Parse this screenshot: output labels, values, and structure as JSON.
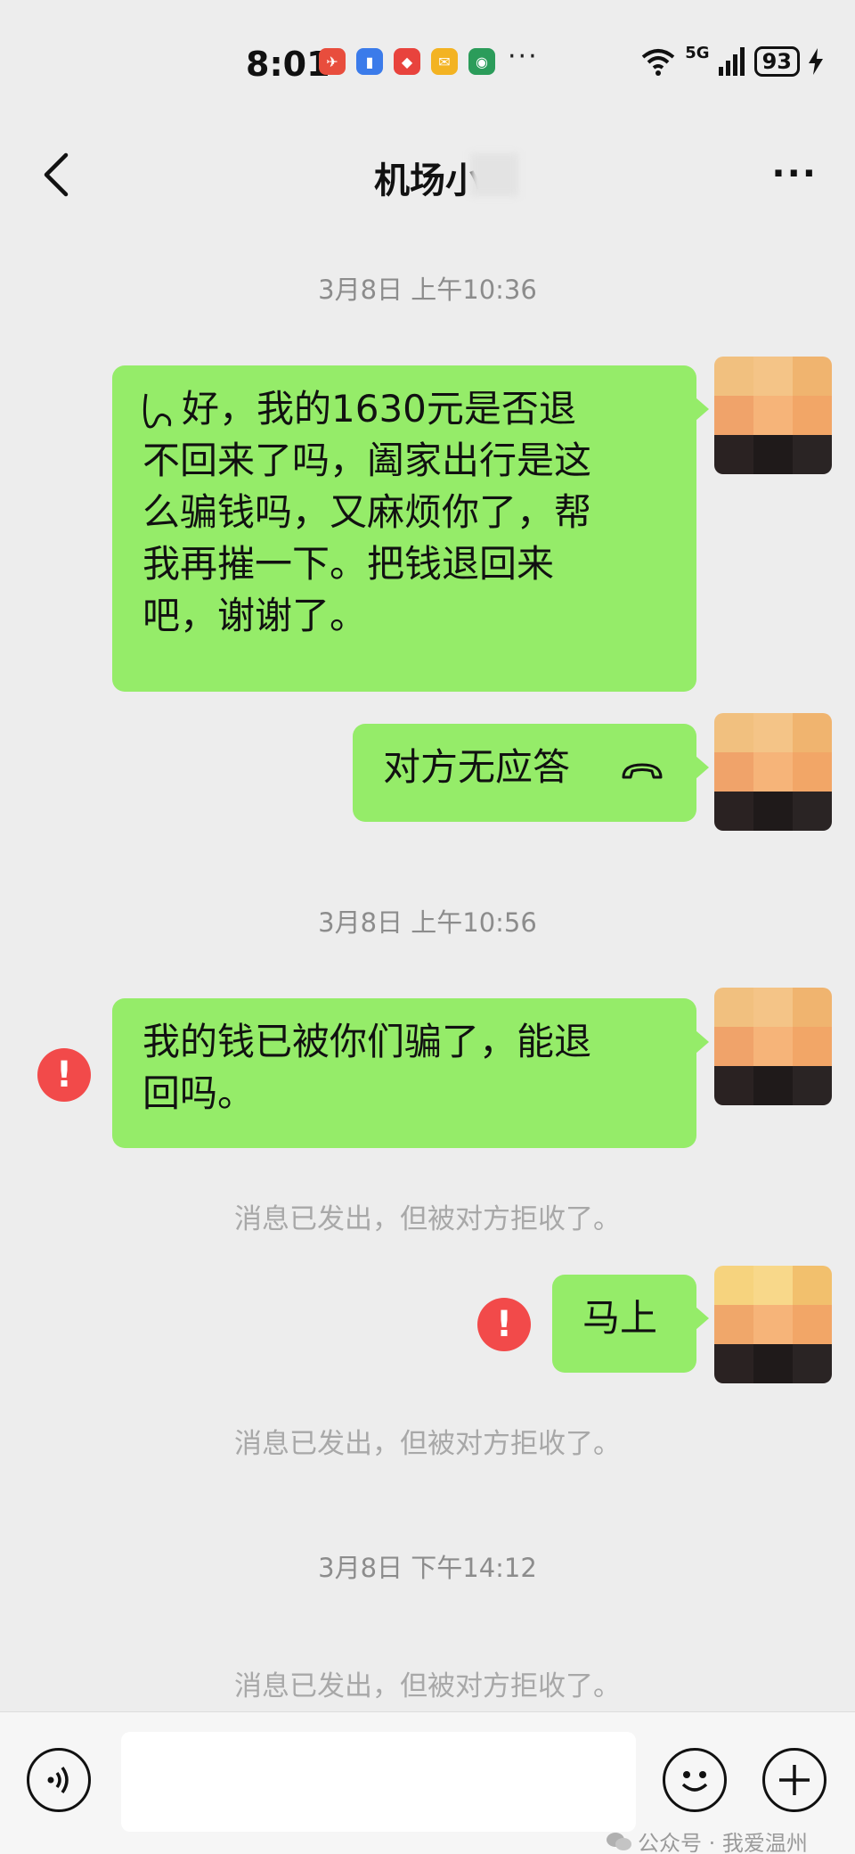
{
  "status_bar": {
    "time": "8:01",
    "network": "5G",
    "battery": "93",
    "more": "···"
  },
  "header": {
    "title": "机场小",
    "back_icon": "chevron-left-icon",
    "more_label": "···"
  },
  "messages": {
    "ts1": "3月8日 上午10:36",
    "m1_lines": [
      "好，我的1630元是否退",
      "不回来了吗，阖家出行是这",
      "么骗钱吗，又麻烦你了，帮",
      "我再摧一下。把钱退回来",
      "吧，谢谢了。"
    ],
    "m2": "对方无应答",
    "ts2": "3月8日 上午10:56",
    "m3_lines": [
      "我的钱已被你们骗了，能退",
      "回吗。"
    ],
    "note1": "消息已发出，但被对方拒收了。",
    "m4": "马上",
    "note2": "消息已发出，但被对方拒收了。",
    "ts3": "3月8日 下午14:12",
    "note3": "消息已发出，但被对方拒收了。"
  },
  "error_mark": "!",
  "input": {
    "placeholder": ""
  },
  "watermark": "公众号 · 我爱温州",
  "colors": {
    "bubble": "#95ec69",
    "background": "#ededed",
    "error": "#f24a4a"
  }
}
